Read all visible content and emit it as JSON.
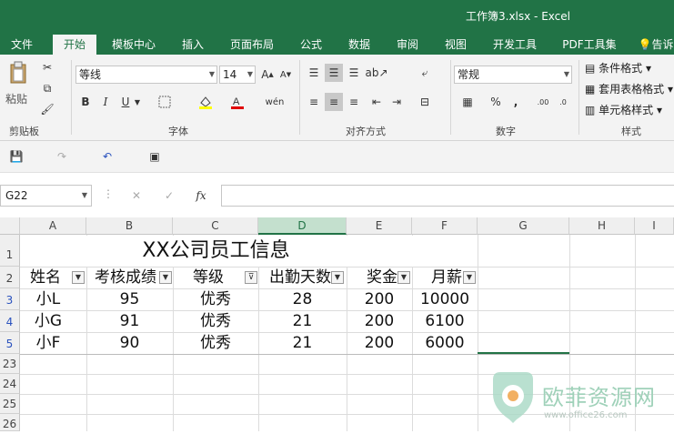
{
  "window": {
    "title": "工作簿3.xlsx - Excel"
  },
  "tabs": [
    "文件",
    "开始",
    "模板中心",
    "插入",
    "页面布局",
    "公式",
    "数据",
    "审阅",
    "视图",
    "开发工具",
    "PDF工具集"
  ],
  "tell_me": "告诉",
  "ribbon": {
    "groups": {
      "clipboard": "剪贴板",
      "font": "字体",
      "alignment": "对齐方式",
      "number": "数字",
      "styles": "样式"
    },
    "paste_label": "粘贴",
    "font_name": "等线",
    "font_size": "14",
    "number_format": "常规",
    "bold": "B",
    "italic": "I",
    "underline": "U",
    "percent": "%",
    "comma": ",",
    "font_color": "#e00000",
    "fill_color": "#ffff00",
    "style_commands": [
      "条件格式",
      "套用表格格式",
      "单元格样式"
    ]
  },
  "formula_bar": {
    "name_box": "G22",
    "fx": "fx",
    "value": ""
  },
  "columns": [
    "A",
    "B",
    "C",
    "D",
    "E",
    "F",
    "G",
    "H",
    "I"
  ],
  "rows": [
    "1",
    "2",
    "3",
    "4",
    "5",
    "23",
    "24",
    "25",
    "26"
  ],
  "sheet": {
    "title": "XX公司员工信息",
    "headers": [
      "姓名",
      "考核成绩",
      "等级",
      "出勤天数",
      "奖金",
      "月薪"
    ],
    "records": [
      [
        "小L",
        "95",
        "优秀",
        "28",
        "200",
        "10000"
      ],
      [
        "小G",
        "91",
        "优秀",
        "21",
        "200",
        "6100"
      ],
      [
        "小F",
        "90",
        "优秀",
        "21",
        "200",
        "6000"
      ]
    ]
  },
  "watermark": {
    "name": "欧菲资源网",
    "url": "www.office26.com"
  }
}
